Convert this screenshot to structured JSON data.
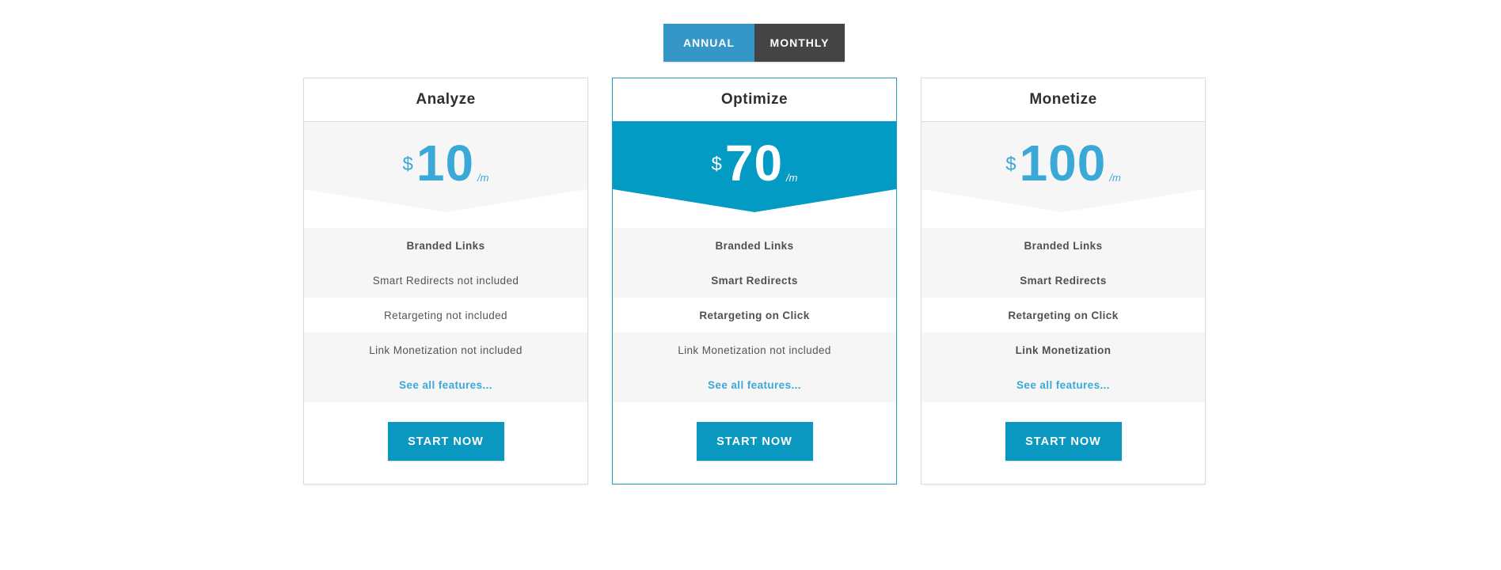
{
  "toggle": {
    "annual_label": "ANNUAL",
    "monthly_label": "MONTHLY",
    "active": "annual"
  },
  "colors": {
    "accent": "#3497c8",
    "featured_fill": "#039ac3",
    "price_text": "#3aa9d8",
    "dark": "#444444"
  },
  "plans": [
    {
      "name": "Analyze",
      "currency": "$",
      "amount": "10",
      "per": "/m",
      "features": [
        "Branded Links",
        "Smart Redirects not included",
        "Retargeting not included",
        "Link Monetization not included"
      ],
      "see_all": "See all features...",
      "cta": "START NOW"
    },
    {
      "name": "Optimize",
      "currency": "$",
      "amount": "70",
      "per": "/m",
      "features": [
        "Branded Links",
        "Smart Redirects",
        "Retargeting on Click",
        "Link Monetization not included"
      ],
      "see_all": "See all features...",
      "cta": "START NOW"
    },
    {
      "name": "Monetize",
      "currency": "$",
      "amount": "100",
      "per": "/m",
      "features": [
        "Branded Links",
        "Smart Redirects",
        "Retargeting on Click",
        "Link Monetization"
      ],
      "see_all": "See all features...",
      "cta": "START NOW"
    }
  ]
}
